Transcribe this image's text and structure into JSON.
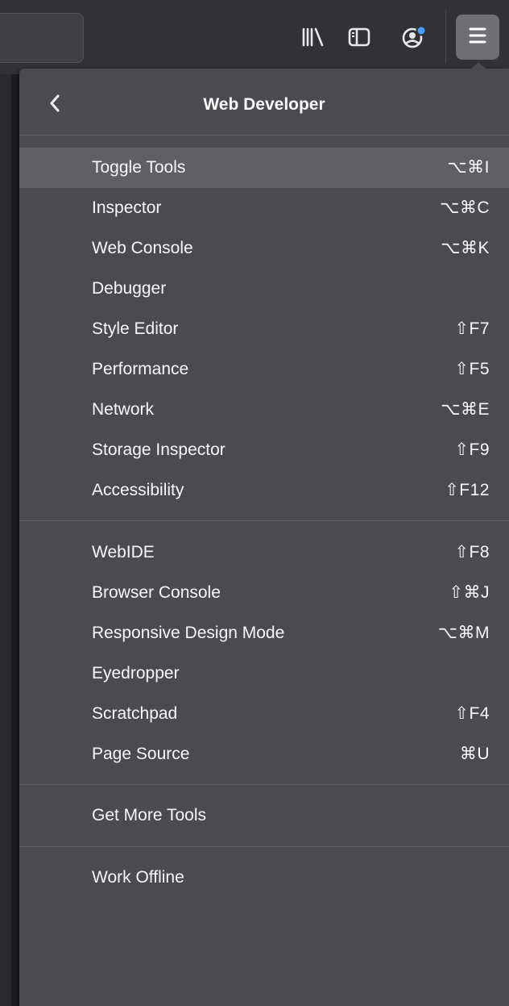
{
  "toolbar": {
    "icons": [
      "library-icon",
      "sidebar-icon",
      "account-icon",
      "menu-icon"
    ],
    "accent_dot": "#45a1ff"
  },
  "panel": {
    "title": "Web Developer",
    "back_glyph": "<"
  },
  "groups": [
    {
      "items": [
        {
          "label": "Toggle Tools",
          "shortcut": "⌥⌘I",
          "highlighted": true
        },
        {
          "label": "Inspector",
          "shortcut": "⌥⌘C"
        },
        {
          "label": "Web Console",
          "shortcut": "⌥⌘K"
        },
        {
          "label": "Debugger",
          "shortcut": ""
        },
        {
          "label": "Style Editor",
          "shortcut": "⇧F7"
        },
        {
          "label": "Performance",
          "shortcut": "⇧F5"
        },
        {
          "label": "Network",
          "shortcut": "⌥⌘E"
        },
        {
          "label": "Storage Inspector",
          "shortcut": "⇧F9"
        },
        {
          "label": "Accessibility",
          "shortcut": "⇧F12"
        }
      ]
    },
    {
      "items": [
        {
          "label": "WebIDE",
          "shortcut": "⇧F8"
        },
        {
          "label": "Browser Console",
          "shortcut": "⇧⌘J"
        },
        {
          "label": "Responsive Design Mode",
          "shortcut": "⌥⌘M"
        },
        {
          "label": "Eyedropper",
          "shortcut": ""
        },
        {
          "label": "Scratchpad",
          "shortcut": "⇧F4"
        },
        {
          "label": "Page Source",
          "shortcut": "⌘U"
        }
      ]
    },
    {
      "items": [
        {
          "label": "Get More Tools",
          "shortcut": ""
        }
      ]
    },
    {
      "items": [
        {
          "label": "Work Offline",
          "shortcut": ""
        }
      ]
    }
  ]
}
